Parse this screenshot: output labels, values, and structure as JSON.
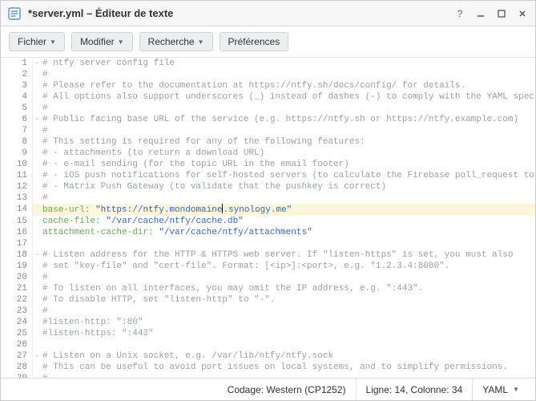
{
  "window": {
    "title": "*server.yml – Éditeur de texte"
  },
  "toolbar": {
    "file": "Fichier",
    "edit": "Modifier",
    "search": "Recherche",
    "prefs": "Préférences"
  },
  "status": {
    "encoding": "Codage: Western (CP1252)",
    "position": "Ligne: 14, Colonne: 34",
    "language": "YAML"
  },
  "highlighted_line": 14,
  "lines": [
    {
      "n": 1,
      "fold": "-",
      "seg": [
        {
          "cls": "c-comment",
          "t": "# ntfy server config file"
        }
      ]
    },
    {
      "n": 2,
      "fold": "",
      "seg": [
        {
          "cls": "c-comment",
          "t": "#"
        }
      ]
    },
    {
      "n": 3,
      "fold": "",
      "seg": [
        {
          "cls": "c-comment",
          "t": "# Please refer to the documentation at https://ntfy.sh/docs/config/ for details."
        }
      ]
    },
    {
      "n": 4,
      "fold": "",
      "seg": [
        {
          "cls": "c-comment",
          "t": "# All options also support underscores (_) instead of dashes (-) to comply with the YAML spec."
        }
      ]
    },
    {
      "n": 5,
      "fold": "",
      "seg": [
        {
          "cls": "c-comment",
          "t": "#"
        }
      ]
    },
    {
      "n": 6,
      "fold": "-",
      "seg": [
        {
          "cls": "c-comment",
          "t": "# Public facing base URL of the service (e.g. https://ntfy.sh or https://ntfy.example.com)"
        }
      ]
    },
    {
      "n": 7,
      "fold": "",
      "seg": [
        {
          "cls": "c-comment",
          "t": "#"
        }
      ]
    },
    {
      "n": 8,
      "fold": "",
      "seg": [
        {
          "cls": "c-comment",
          "t": "# This setting is required for any of the following features:"
        }
      ]
    },
    {
      "n": 9,
      "fold": "",
      "seg": [
        {
          "cls": "c-comment",
          "t": "# - attachments (to return a download URL)"
        }
      ]
    },
    {
      "n": 10,
      "fold": "",
      "seg": [
        {
          "cls": "c-comment",
          "t": "# - e-mail sending (for the topic URL in the email footer)"
        }
      ]
    },
    {
      "n": 11,
      "fold": "",
      "seg": [
        {
          "cls": "c-comment",
          "t": "# - iOS push notifications for self-hosted servers (to calculate the Firebase poll_request topic)"
        }
      ]
    },
    {
      "n": 12,
      "fold": "",
      "seg": [
        {
          "cls": "c-comment",
          "t": "# - Matrix Push Gateway (to validate that the pushkey is correct)"
        }
      ]
    },
    {
      "n": 13,
      "fold": "",
      "seg": [
        {
          "cls": "c-comment",
          "t": "#"
        }
      ]
    },
    {
      "n": 14,
      "fold": "",
      "seg": [
        {
          "cls": "c-key",
          "t": "base-url:"
        },
        {
          "cls": "",
          "t": " "
        },
        {
          "cls": "c-string",
          "t": "\"https://ntfy.mondomaine"
        },
        {
          "cls": "",
          "t": "",
          "cursor": true
        },
        {
          "cls": "c-string",
          "t": ".synology.me\""
        }
      ]
    },
    {
      "n": 15,
      "fold": "",
      "seg": [
        {
          "cls": "c-key",
          "t": "cache-file:"
        },
        {
          "cls": "",
          "t": " "
        },
        {
          "cls": "c-string",
          "t": "\"/var/cache/ntfy/cache.db\""
        }
      ]
    },
    {
      "n": 16,
      "fold": "",
      "seg": [
        {
          "cls": "c-key",
          "t": "attachment-cache-dir:"
        },
        {
          "cls": "",
          "t": " "
        },
        {
          "cls": "c-string",
          "t": "\"/var/cache/ntfy/attachments\""
        }
      ]
    },
    {
      "n": 17,
      "fold": "",
      "seg": [
        {
          "cls": "",
          "t": ""
        }
      ]
    },
    {
      "n": 18,
      "fold": "-",
      "seg": [
        {
          "cls": "c-comment",
          "t": "# Listen address for the HTTP & HTTPS web server. If \"listen-https\" is set, you must also"
        }
      ]
    },
    {
      "n": 19,
      "fold": "",
      "seg": [
        {
          "cls": "c-comment",
          "t": "# set \"key-file\" and \"cert-file\". Format: [<ip>]:<port>, e.g. \"1.2.3.4:8080\"."
        }
      ]
    },
    {
      "n": 20,
      "fold": "",
      "seg": [
        {
          "cls": "c-comment",
          "t": "#"
        }
      ]
    },
    {
      "n": 21,
      "fold": "",
      "seg": [
        {
          "cls": "c-comment",
          "t": "# To listen on all interfaces, you may omit the IP address, e.g. \":443\"."
        }
      ]
    },
    {
      "n": 22,
      "fold": "",
      "seg": [
        {
          "cls": "c-comment",
          "t": "# To disable HTTP, set \"listen-http\" to \"-\"."
        }
      ]
    },
    {
      "n": 23,
      "fold": "",
      "seg": [
        {
          "cls": "c-comment",
          "t": "#"
        }
      ]
    },
    {
      "n": 24,
      "fold": "",
      "seg": [
        {
          "cls": "c-comment",
          "t": "#listen-http: \":80\""
        }
      ]
    },
    {
      "n": 25,
      "fold": "",
      "seg": [
        {
          "cls": "c-comment",
          "t": "#listen-https: \":443\""
        }
      ]
    },
    {
      "n": 26,
      "fold": "",
      "seg": [
        {
          "cls": "",
          "t": ""
        }
      ]
    },
    {
      "n": 27,
      "fold": "-",
      "seg": [
        {
          "cls": "c-comment",
          "t": "# Listen on a Unix socket, e.g. /var/lib/ntfy/ntfy.sock"
        }
      ]
    },
    {
      "n": 28,
      "fold": "",
      "seg": [
        {
          "cls": "c-comment",
          "t": "# This can be useful to avoid port issues on local systems, and to simplify permissions."
        }
      ]
    },
    {
      "n": 29,
      "fold": "",
      "seg": [
        {
          "cls": "c-comment",
          "t": "#"
        }
      ]
    }
  ]
}
